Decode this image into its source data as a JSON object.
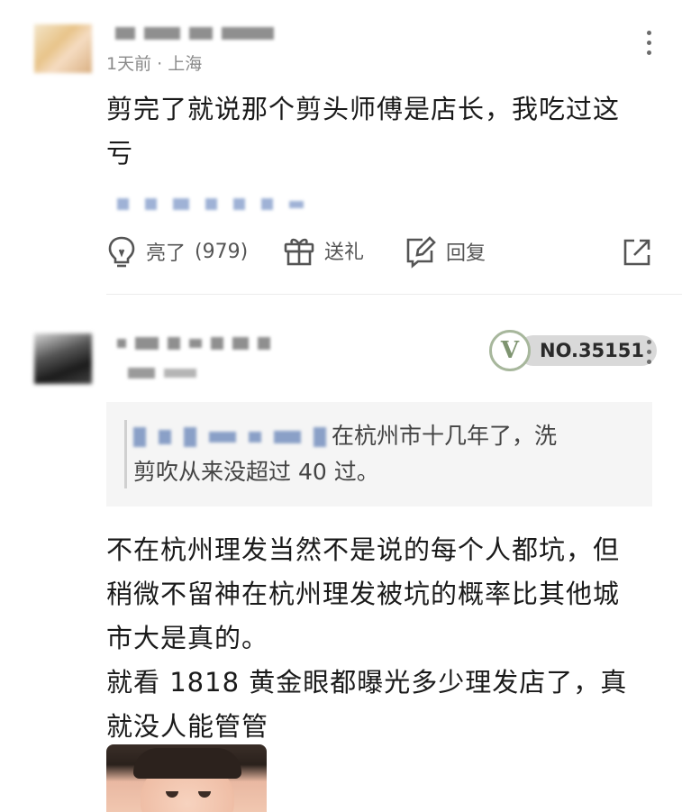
{
  "comment1": {
    "meta": "1天前 · 上海",
    "text_line1": "剪完了就说那个剪头师傅是店长，我吃过这",
    "text_line2": "亏",
    "actions": {
      "like_label": "亮了",
      "like_count": "(979)",
      "gift_label": "送礼",
      "reply_label": "回复"
    }
  },
  "comment2": {
    "badge": "NO.35151",
    "quote_text_a": "在杭州市十几年了，洗",
    "quote_text_b": "剪吹从来没超过 40 过。",
    "lines": [
      "不在杭州理发当然不是说的每个人都坑，但",
      "稍微不留神在杭州理发被坑的概率比其他城",
      "市大是真的。",
      "就看 1818 黄金眼都曝光多少理发店了，真",
      "就没人能管管"
    ]
  },
  "icons": {
    "like": "lightbulb-icon",
    "gift": "gift-icon",
    "reply": "edit-icon",
    "share": "share-icon",
    "more": "kebab-icon"
  }
}
